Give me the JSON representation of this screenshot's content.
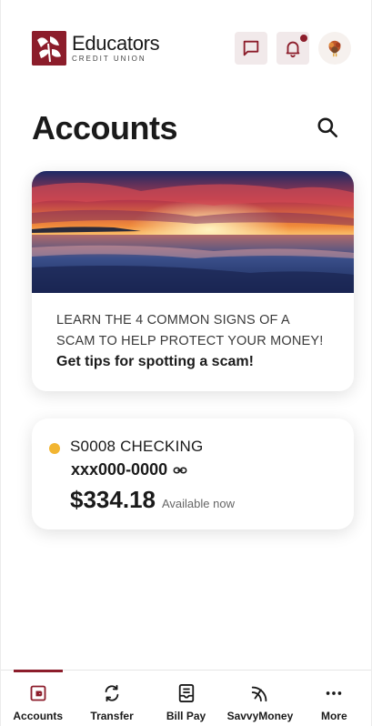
{
  "brand": {
    "name": "Educators",
    "subtitle": "CREDIT UNION",
    "color": "#8c1d2b"
  },
  "header": {
    "messages_icon": "chat-bubble-icon",
    "notifications_icon": "bell-icon",
    "notifications_has_unread": true,
    "avatar_icon": "turkey-avatar"
  },
  "page": {
    "title": "Accounts",
    "search_icon": "search-icon"
  },
  "promo": {
    "line1": "LEARN THE 4 COMMON SIGNS OF A",
    "line2": "SCAM TO HELP PROTECT YOUR MONEY!",
    "cta": "Get tips for spotting a scam!"
  },
  "account": {
    "name": "S0008 CHECKING",
    "number": "xxx000-0000",
    "balance": "$334.18",
    "balance_note": "Available now",
    "status_color": "#f2b531",
    "link_icon": "link-icon"
  },
  "nav": [
    {
      "label": "Accounts",
      "icon": "accounts-icon",
      "active": true
    },
    {
      "label": "Transfer",
      "icon": "transfer-icon",
      "active": false
    },
    {
      "label": "Bill Pay",
      "icon": "bill-pay-icon",
      "active": false
    },
    {
      "label": "SavvyMoney",
      "icon": "savvymoney-icon",
      "active": false
    },
    {
      "label": "More",
      "icon": "more-icon",
      "active": false
    }
  ]
}
